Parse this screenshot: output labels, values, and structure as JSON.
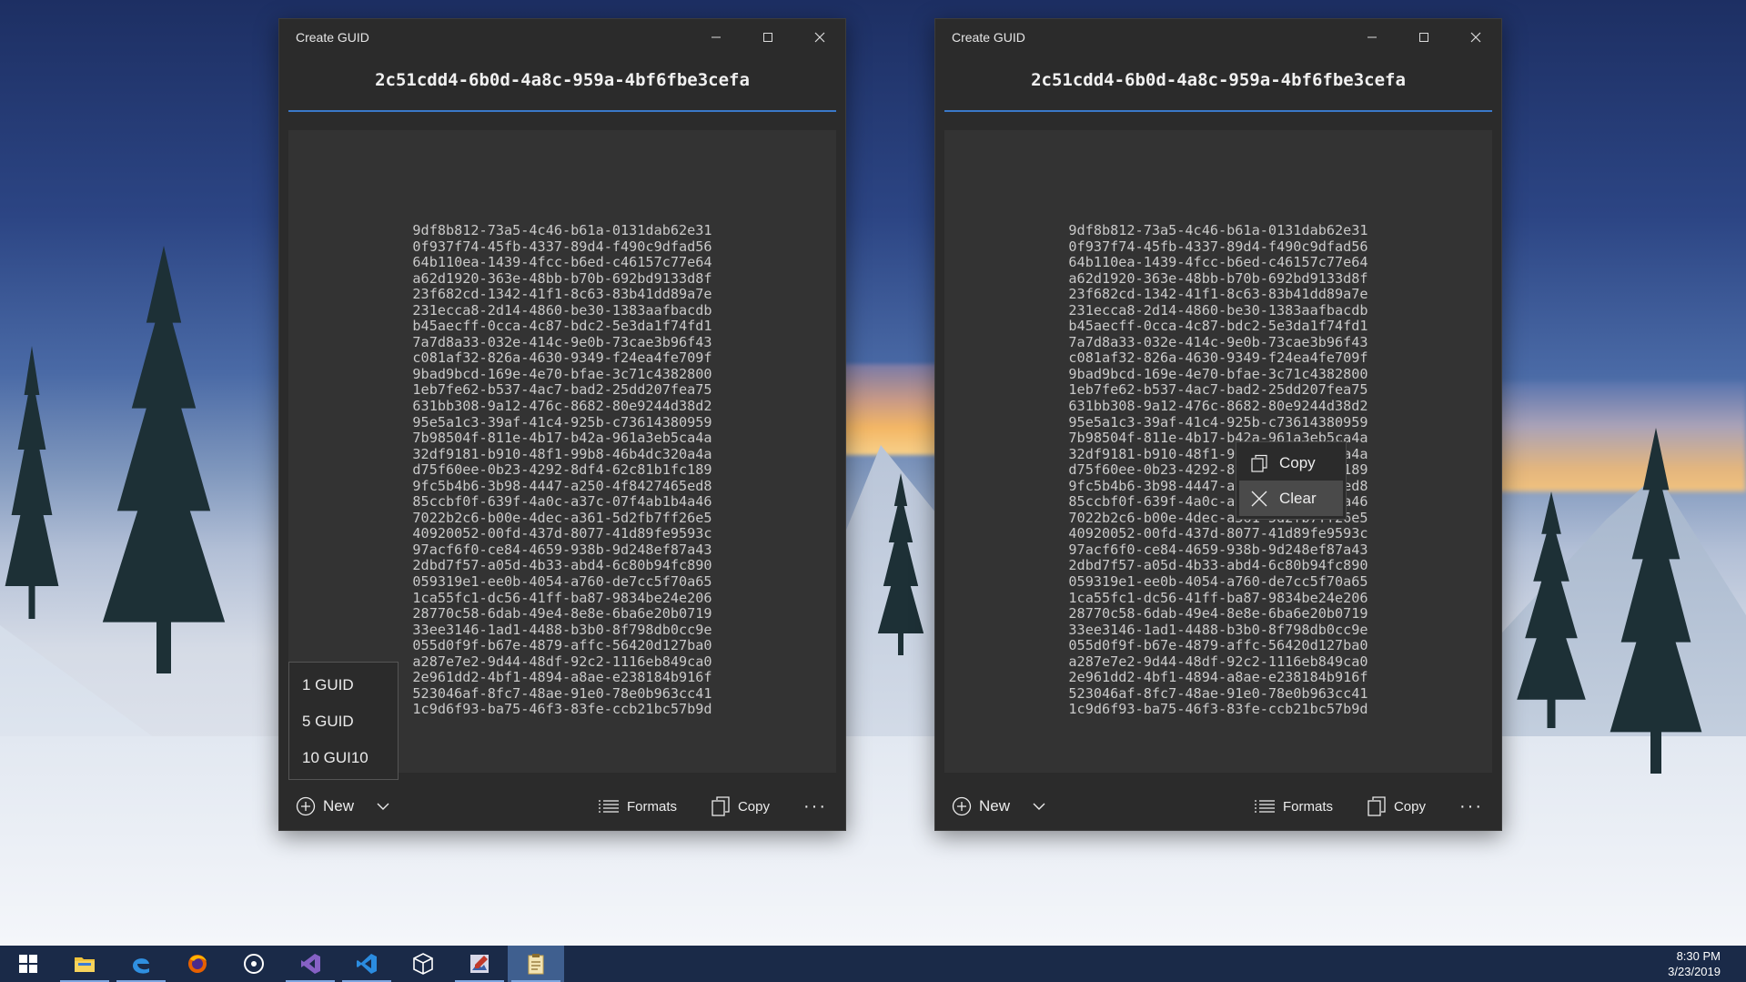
{
  "app": {
    "title": "Create GUID",
    "current_guid": "2c51cdd4-6b0d-4a8c-959a-4bf6fbe3cefa",
    "accent_color": "#3a78c8"
  },
  "guid_list": [
    "9df8b812-73a5-4c46-b61a-0131dab62e31",
    "0f937f74-45fb-4337-89d4-f490c9dfad56",
    "64b110ea-1439-4fcc-b6ed-c46157c77e64",
    "a62d1920-363e-48bb-b70b-692bd9133d8f",
    "23f682cd-1342-41f1-8c63-83b41dd89a7e",
    "231ecca8-2d14-4860-be30-1383aafbacdb",
    "b45aecff-0cca-4c87-bdc2-5e3da1f74fd1",
    "7a7d8a33-032e-414c-9e0b-73cae3b96f43",
    "c081af32-826a-4630-9349-f24ea4fe709f",
    "9bad9bcd-169e-4e70-bfae-3c71c4382800",
    "1eb7fe62-b537-4ac7-bad2-25dd207fea75",
    "631bb308-9a12-476c-8682-80e9244d38d2",
    "95e5a1c3-39af-41c4-925b-c73614380959",
    "7b98504f-811e-4b17-b42a-961a3eb5ca4a",
    "32df9181-b910-48f1-99b8-46b4dc320a4a",
    "d75f60ee-0b23-4292-8df4-62c81b1fc189",
    "9fc5b4b6-3b98-4447-a250-4f8427465ed8",
    "85ccbf0f-639f-4a0c-a37c-07f4ab1b4a46",
    "7022b2c6-b00e-4dec-a361-5d2fb7ff26e5",
    "40920052-00fd-437d-8077-41d89fe9593c",
    "97acf6f0-ce84-4659-938b-9d248ef87a43",
    "2dbd7f57-a05d-4b33-abd4-6c80b94fc890",
    "059319e1-ee0b-4054-a760-de7cc5f70a65",
    "1ca55fc1-dc56-41ff-ba87-9834be24e206",
    "28770c58-6dab-49e4-8e8e-6ba6e20b0719",
    "33ee3146-1ad1-4488-b3b0-8f798db0cc9e",
    "055d0f9f-b67e-4879-affc-56420d127ba0",
    "a287e7e2-9d44-48df-92c2-1116eb849ca0",
    "2e961dd2-4bf1-4894-a8ae-e238184b916f",
    "523046af-8fc7-48ae-91e0-78e0b963cc41",
    "1c9d6f93-ba75-46f3-83fe-ccb21bc57b9d"
  ],
  "bottom_bar": {
    "new_label": "New",
    "formats_label": "Formats",
    "copy_label": "Copy",
    "more_label": "···"
  },
  "new_dropdown": {
    "items": [
      "1 GUID",
      "5 GUID",
      "10 GUI10"
    ]
  },
  "context_menu": {
    "items": [
      {
        "label": "Copy",
        "icon": "copy-icon"
      },
      {
        "label": "Clear",
        "icon": "close-icon"
      }
    ]
  },
  "taskbar": {
    "icons": [
      "windows-start-icon",
      "file-explorer-icon",
      "edge-icon",
      "firefox-icon",
      "groove-music-icon",
      "visual-studio-icon",
      "vscode-icon",
      "3d-viewer-icon",
      "photo-editor-icon",
      "clipboard-guid-app-icon"
    ],
    "time": "8:30 PM",
    "date": "3/23/2019"
  }
}
